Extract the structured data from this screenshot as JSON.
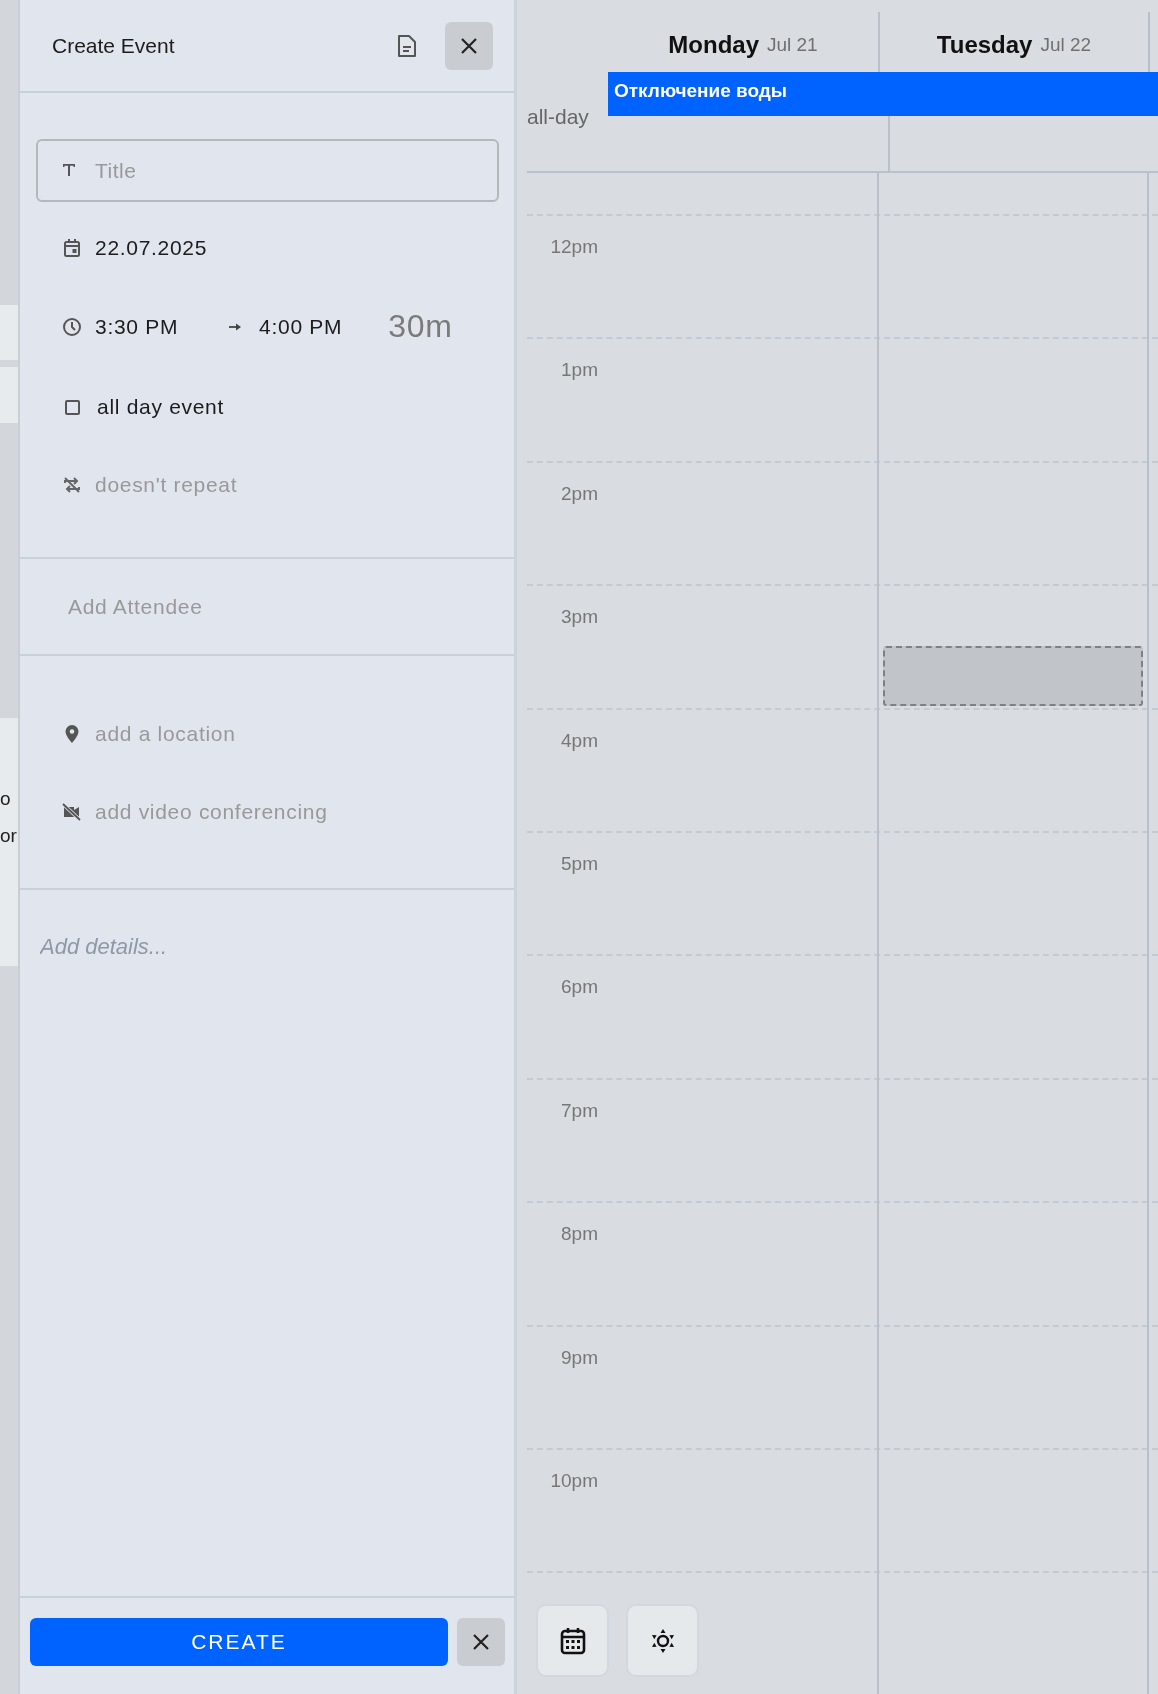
{
  "background": {
    "fragments": [
      "o",
      "or"
    ]
  },
  "panel": {
    "title": "Create Event",
    "title_field": {
      "placeholder": "Title"
    },
    "date": "22.07.2025",
    "start_time": "3:30 PM",
    "end_time": "4:00 PM",
    "duration": "30m",
    "all_day": {
      "label": "all day event",
      "checked": false
    },
    "repeat": "doesn't repeat",
    "attendee": {
      "placeholder": "Add Attendee"
    },
    "location": {
      "placeholder": "add a location"
    },
    "video": {
      "placeholder": "add video conferencing"
    },
    "details": {
      "placeholder": "Add details..."
    },
    "create_button": "CREATE"
  },
  "calendar": {
    "days": [
      {
        "name": "Monday",
        "date": "Jul 21"
      },
      {
        "name": "Tuesday",
        "date": "Jul 22"
      }
    ],
    "all_day_label": "all-day",
    "all_day_events": [
      {
        "title": "Отключение воды"
      }
    ],
    "hours": [
      "12pm",
      "1pm",
      "2pm",
      "3pm",
      "4pm",
      "5pm",
      "6pm",
      "7pm",
      "8pm",
      "9pm",
      "10pm"
    ]
  }
}
